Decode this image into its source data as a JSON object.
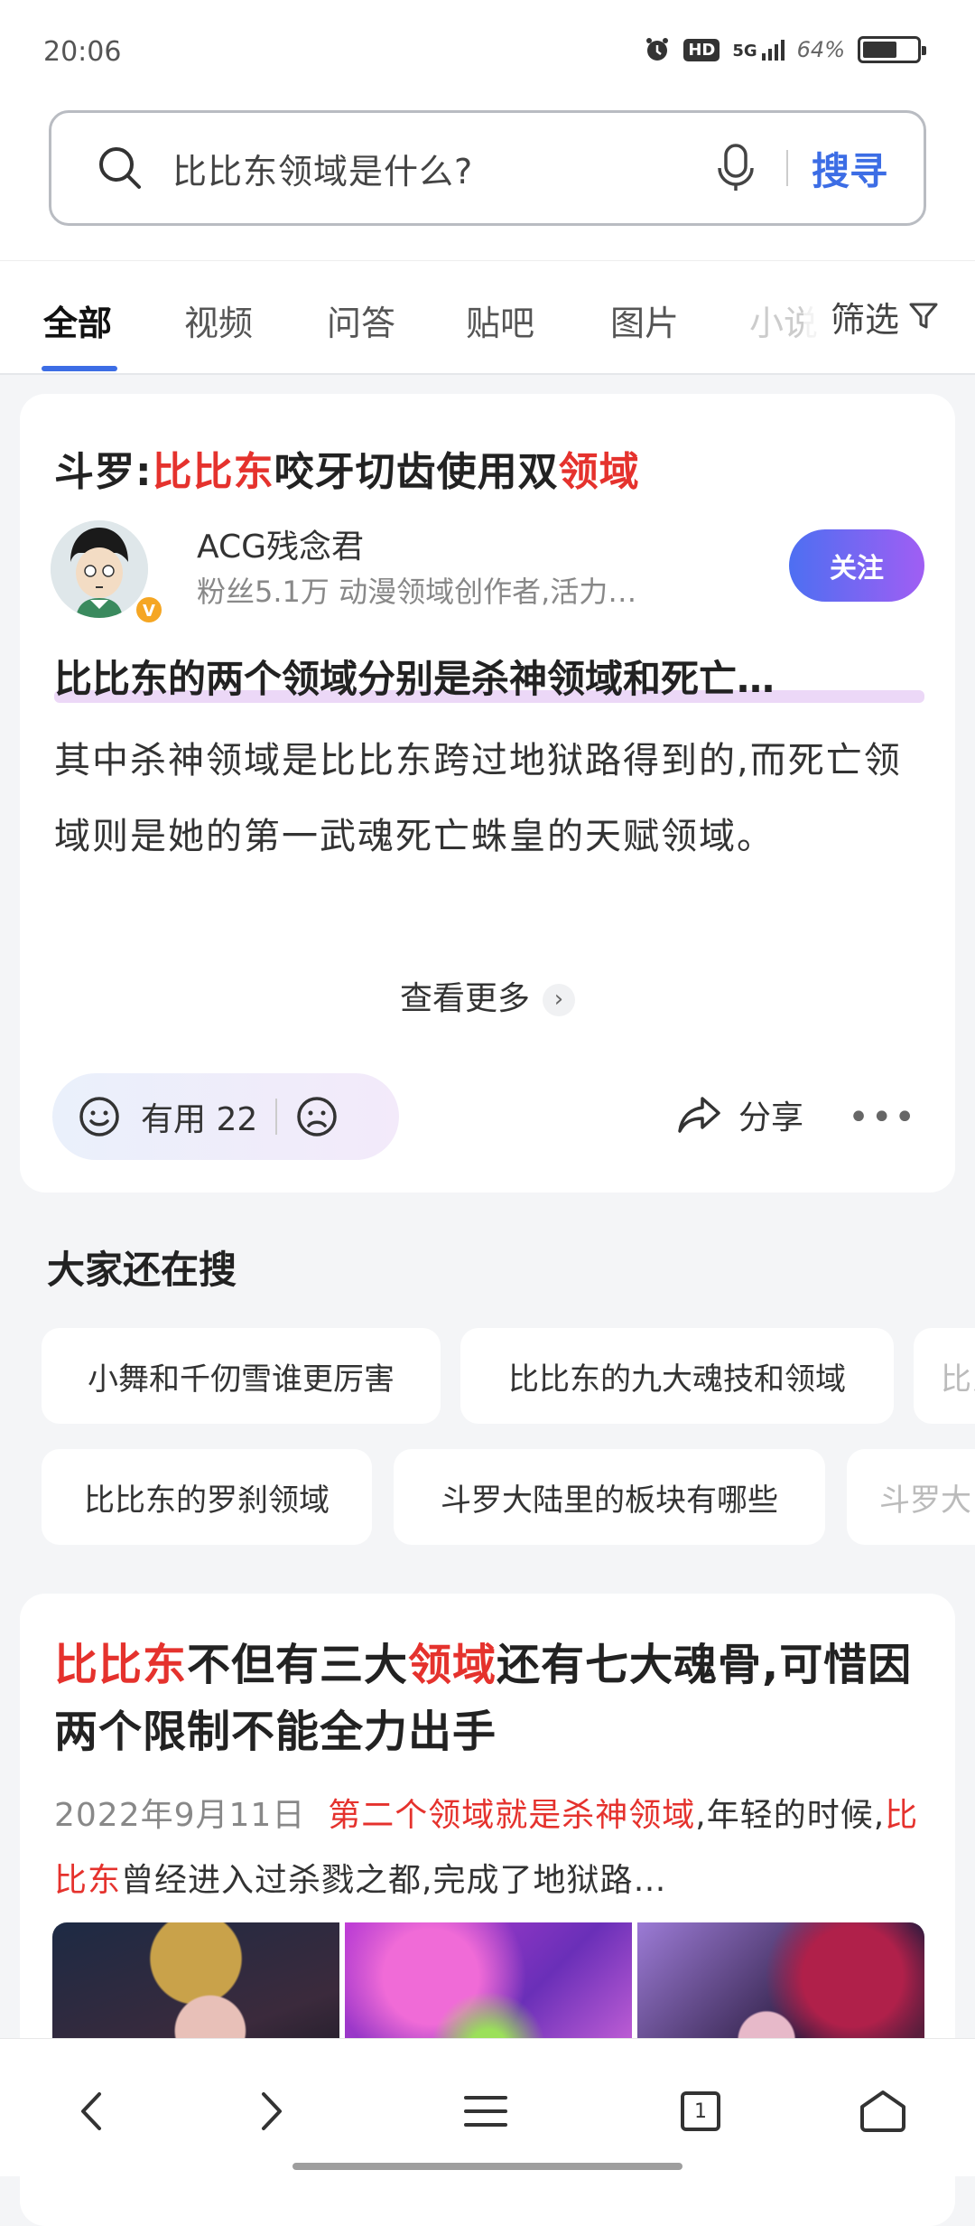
{
  "status_bar": {
    "time": "20:06",
    "hd_label": "HD",
    "network": "5G",
    "battery_percent": "64%",
    "battery_level": 0.64
  },
  "search": {
    "query": "比比东领域是什么?",
    "button_label": "搜寻"
  },
  "tabs": {
    "items": [
      "全部",
      "视频",
      "问答",
      "贴吧",
      "图片",
      "小说"
    ],
    "active_index": 0,
    "filter_label": "筛选"
  },
  "result1": {
    "title_prefix": "斗罗:",
    "title_highlight1": "比比东",
    "title_middle": "咬牙切齿使用双",
    "title_highlight2": "领域",
    "author_name": "ACG残念君",
    "author_desc": "粉丝5.1万 动漫领域创作者,活力…",
    "verified_badge": "V",
    "follow_label": "关注",
    "answer_headline": "比比东的两个领域分别是杀神领域和死亡…",
    "answer_body": "其中杀神领域是比比东跨过地狱路得到的,而死亡领域则是她的第一武魂死亡蛛皇的天赋领域。",
    "see_more_label": "查看更多",
    "useful_label": "有用 22",
    "share_label": "分享"
  },
  "also_search": {
    "title": "大家还在搜",
    "chips_row1": [
      "小舞和千仞雪谁更厉害",
      "比比东的九大魂技和领域",
      "比比"
    ],
    "chips_row2": [
      "比比东的罗刹领域",
      "斗罗大陆里的板块有哪些",
      "斗罗大"
    ]
  },
  "result2": {
    "title_highlight1": "比比东",
    "title_part1": "不但有三大",
    "title_highlight2": "领域",
    "title_part2": "还有七大魂骨,可惜因两个限制不能全力出手",
    "date": "2022年9月11日",
    "snippet_highlight1": "第二个领域就是杀神领域",
    "snippet_part1": ",年轻的时候,",
    "snippet_highlight2": "比比东",
    "snippet_part2": "曾经进入过杀戮之都,完成了地狱路…"
  },
  "navbar": {
    "icons": [
      "back-icon",
      "forward-icon",
      "menu-icon",
      "tabs-icon",
      "home-icon"
    ],
    "tab_count": "1"
  }
}
